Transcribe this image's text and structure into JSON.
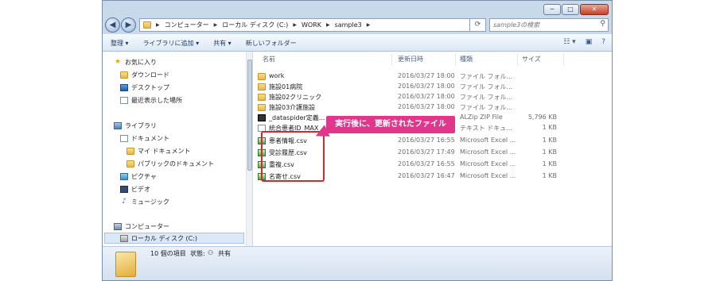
{
  "window_buttons": {
    "minimize": "─",
    "maximize": "□",
    "close": "✕"
  },
  "nav": {
    "back": "◀",
    "forward": "▶"
  },
  "breadcrumb": [
    "コンピューター",
    "ローカル ディスク (C:)",
    "WORK",
    "sample3"
  ],
  "search": {
    "placeholder": "sample3の検索"
  },
  "toolbar": {
    "organize": "整理 ▾",
    "add_library": "ライブラリに追加 ▾",
    "share": "共有 ▾",
    "new_folder": "新しいフォルダー"
  },
  "sidebar": {
    "items": [
      {
        "label": "お気に入り",
        "icon": "star-icon"
      },
      {
        "label": "ダウンロード",
        "icon": "folder-icon"
      },
      {
        "label": "デスクトップ",
        "icon": "desktop-icon"
      },
      {
        "label": "最近表示した場所",
        "icon": "recent-places-icon"
      },
      {
        "label": "ライブラリ",
        "icon": "library-icon"
      },
      {
        "label": "ドキュメント",
        "icon": "document-icon"
      },
      {
        "label": "マイ ドキュメント",
        "icon": "folder-icon"
      },
      {
        "label": "パブリックのドキュメント",
        "icon": "folder-icon"
      },
      {
        "label": "ピクチャ",
        "icon": "picture-icon"
      },
      {
        "label": "ビデオ",
        "icon": "video-icon"
      },
      {
        "label": "ミュージック",
        "icon": "music-icon"
      },
      {
        "label": "コンピューター",
        "icon": "computer-icon"
      },
      {
        "label": "ローカル ディスク (C:)",
        "icon": "drive-icon"
      }
    ]
  },
  "columns": {
    "name": "名前",
    "date": "更新日時",
    "type": "種類",
    "size": "サイズ"
  },
  "files": [
    {
      "name": "work",
      "date": "2016/03/27 18:00",
      "type": "ファイル フォル...",
      "size": "",
      "kind": "folder"
    },
    {
      "name": "施設01病院",
      "date": "2016/03/27 18:00",
      "type": "ファイル フォル...",
      "size": "",
      "kind": "folder"
    },
    {
      "name": "施設02クリニック",
      "date": "2016/03/27 18:00",
      "type": "ファイル フォル...",
      "size": "",
      "kind": "folder"
    },
    {
      "name": "施設03介護施設",
      "date": "2016/03/27 18:00",
      "type": "ファイル フォル...",
      "size": "",
      "kind": "folder"
    },
    {
      "name": "_dataspider定義...",
      "date": "",
      "type": "ALZip ZIP File",
      "size": "5,796 KB",
      "kind": "zip"
    },
    {
      "name": "統合患者ID_MAX",
      "date": "",
      "type": "テキスト ドキュ...",
      "size": "1 KB",
      "kind": "txt"
    },
    {
      "name": "患者情報.csv",
      "date": "2016/03/27 16:55",
      "type": "Microsoft Excel ...",
      "size": "1 KB",
      "kind": "csv"
    },
    {
      "name": "受診履歴.csv",
      "date": "2016/03/27 17:49",
      "type": "Microsoft Excel ...",
      "size": "1 KB",
      "kind": "csv"
    },
    {
      "name": "重複.csv",
      "date": "2016/03/27 16:55",
      "type": "Microsoft Excel ...",
      "size": "1 KB",
      "kind": "csv"
    },
    {
      "name": "名寄せ.csv",
      "date": "2016/03/27 16:47",
      "type": "Microsoft Excel ...",
      "size": "1 KB",
      "kind": "csv"
    }
  ],
  "callout": "実行後に、更新されたファイル",
  "status": {
    "count": "10 個の項目",
    "state_label": "状態:",
    "state_value": "共有"
  }
}
